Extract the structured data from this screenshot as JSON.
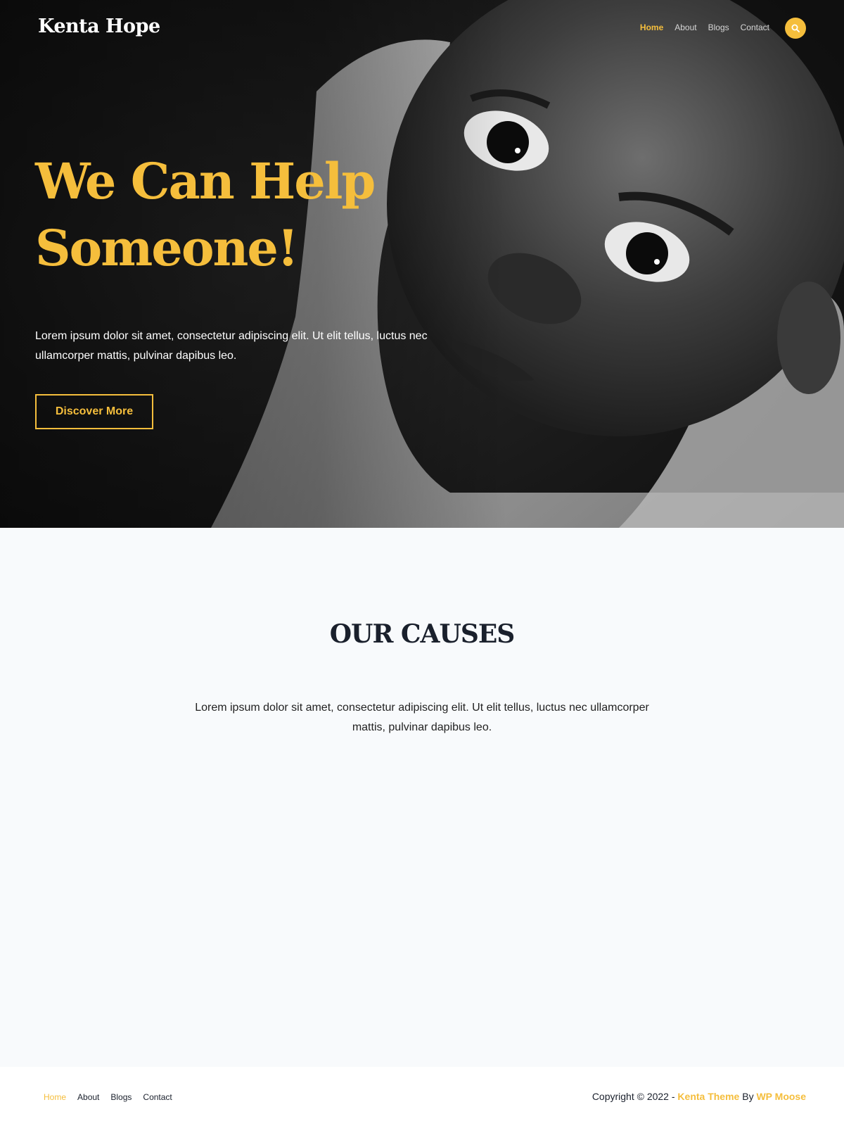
{
  "header": {
    "logo": "Kenta Hope",
    "nav": [
      {
        "label": "Home",
        "active": true
      },
      {
        "label": "About",
        "active": false
      },
      {
        "label": "Blogs",
        "active": false
      },
      {
        "label": "Contact",
        "active": false
      }
    ],
    "search_icon": "search-icon"
  },
  "hero": {
    "title_line1": "We Can Help",
    "title_line2": "Someone!",
    "text": "Lorem ipsum dolor sit amet, consectetur adipiscing elit. Ut elit tellus, luctus nec ullamcorper mattis, pulvinar dapibus leo.",
    "button_label": "Discover More"
  },
  "causes": {
    "title": "OUR CAUSES",
    "text": "Lorem ipsum dolor sit amet, consectetur adipiscing elit. Ut elit tellus, luctus nec ullamcorper mattis, pulvinar dapibus leo."
  },
  "footer": {
    "nav": [
      {
        "label": "Home",
        "active": true
      },
      {
        "label": "About",
        "active": false
      },
      {
        "label": "Blogs",
        "active": false
      },
      {
        "label": "Contact",
        "active": false
      }
    ],
    "copyright_prefix": "Copyright © 2022 - ",
    "theme_link": "Kenta Theme",
    "by": " By ",
    "author_link": "WP Moose"
  },
  "colors": {
    "accent": "#f5be3c",
    "dark": "#1a202c",
    "section_bg": "#f8fafc"
  }
}
